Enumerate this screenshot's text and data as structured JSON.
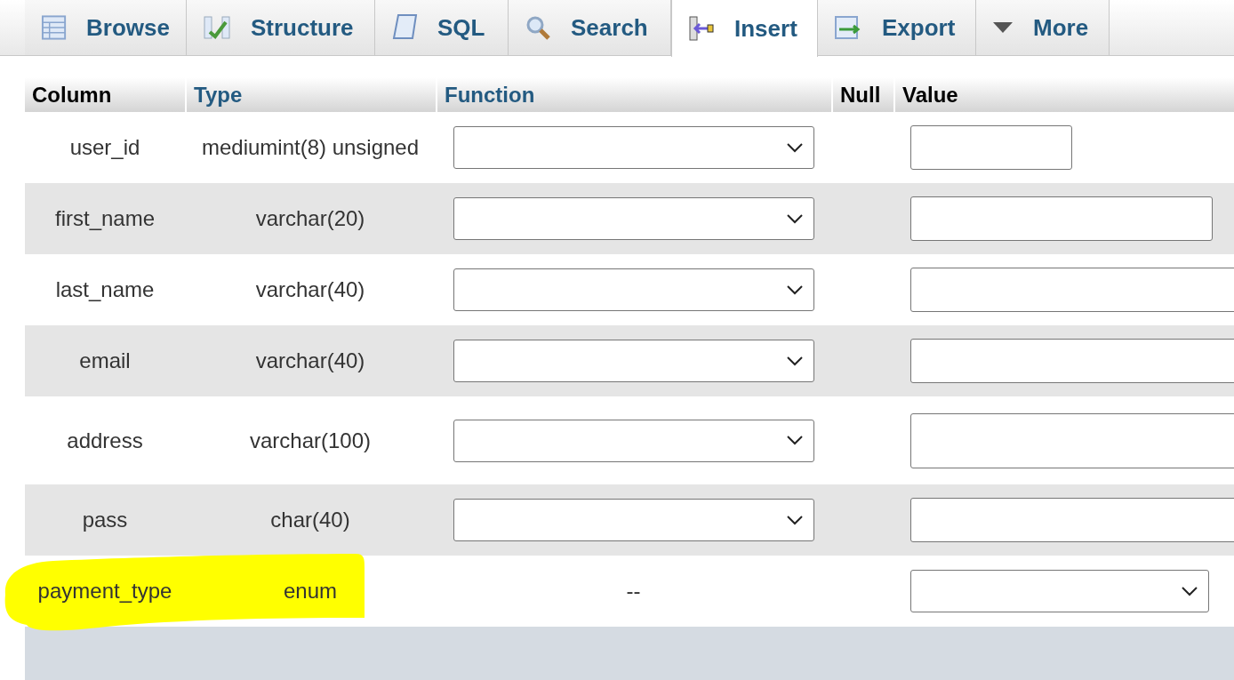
{
  "tabs": [
    {
      "label": "Browse",
      "selected": false
    },
    {
      "label": "Structure",
      "selected": false
    },
    {
      "label": "SQL",
      "selected": false
    },
    {
      "label": "Search",
      "selected": false
    },
    {
      "label": "Insert",
      "selected": true
    },
    {
      "label": "Export",
      "selected": false
    },
    {
      "label": "More",
      "selected": false
    }
  ],
  "table": {
    "columns": [
      {
        "label": "Column",
        "sortable": false
      },
      {
        "label": "Type",
        "sortable": true
      },
      {
        "label": "Function",
        "sortable": true
      },
      {
        "label": "Null",
        "sortable": false
      },
      {
        "label": "Value",
        "sortable": false
      }
    ],
    "rows": [
      {
        "column": "user_id",
        "type": "mediumint(8) unsigned",
        "function": {
          "kind": "select"
        },
        "value": {
          "kind": "short-input"
        },
        "highlighted": false
      },
      {
        "column": "first_name",
        "type": "varchar(20)",
        "function": {
          "kind": "select"
        },
        "value": {
          "kind": "medium-input"
        },
        "highlighted": false
      },
      {
        "column": "last_name",
        "type": "varchar(40)",
        "function": {
          "kind": "select"
        },
        "value": {
          "kind": "input"
        },
        "highlighted": false
      },
      {
        "column": "email",
        "type": "varchar(40)",
        "function": {
          "kind": "select"
        },
        "value": {
          "kind": "input"
        },
        "highlighted": false
      },
      {
        "column": "address",
        "type": "varchar(100)",
        "function": {
          "kind": "select"
        },
        "value": {
          "kind": "textarea"
        },
        "highlighted": false
      },
      {
        "column": "pass",
        "type": "char(40)",
        "function": {
          "kind": "select"
        },
        "value": {
          "kind": "input"
        },
        "highlighted": false
      },
      {
        "column": "payment_type",
        "type": "enum",
        "function": {
          "kind": "text",
          "text": "--"
        },
        "value": {
          "kind": "select"
        },
        "highlighted": true
      }
    ]
  }
}
